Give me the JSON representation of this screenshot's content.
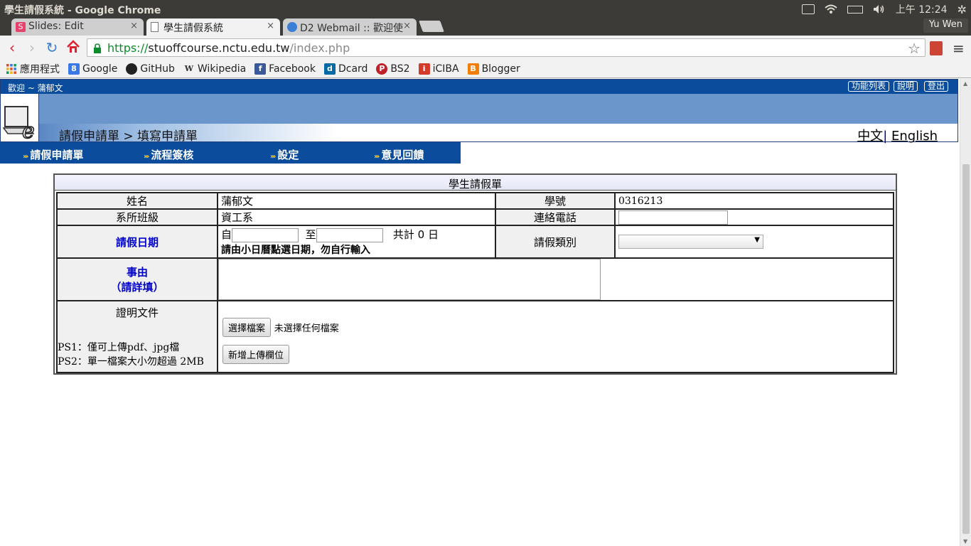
{
  "os": {
    "window_title": "學生請假系統 - Google Chrome",
    "clock": "上午 12:24"
  },
  "tabs": [
    {
      "label": "Slides: Edit",
      "active": false
    },
    {
      "label": "學生請假系統",
      "active": true
    },
    {
      "label": "D2 Webmail :: 歡迎使",
      "active": false
    }
  ],
  "profile_name": "Yu Wen",
  "address": {
    "scheme": "https://",
    "host": "stuoffcourse.nctu.edu.tw",
    "path": "/index.php"
  },
  "bookmarks": [
    {
      "label": "應用程式",
      "icon": "apps-grid-icon",
      "color": "#e34c26"
    },
    {
      "label": "Google",
      "icon": "google-icon",
      "color": "#3b78e7"
    },
    {
      "label": "GitHub",
      "icon": "github-icon",
      "color": "#222222"
    },
    {
      "label": "Wikipedia",
      "icon": "wikipedia-icon",
      "color": "#555555"
    },
    {
      "label": "Facebook",
      "icon": "facebook-icon",
      "color": "#3b5998"
    },
    {
      "label": "Dcard",
      "icon": "dcard-icon",
      "color": "#006aa6"
    },
    {
      "label": "BS2",
      "icon": "bs2-icon",
      "color": "#c0202a"
    },
    {
      "label": "iCIBA",
      "icon": "iciba-icon",
      "color": "#d33a2c"
    },
    {
      "label": "Blogger",
      "icon": "blogger-icon",
      "color": "#f57d00"
    }
  ],
  "header": {
    "welcome": "歡迎 ~ 蒲郁文",
    "links": [
      "功能列表",
      "說明",
      "登出"
    ],
    "breadcrumb": "請假申請單 > 填寫申請單",
    "lang_zh": "中文",
    "lang_sep": "|",
    "lang_en": "English"
  },
  "nav": [
    "請假申請單",
    "流程簽核",
    "設定",
    "意見回饋"
  ],
  "form": {
    "title": "學生請假單",
    "name_label": "姓名",
    "name_value": "蒲郁文",
    "student_id_label": "學號",
    "student_id_value": "0316213",
    "dept_label": "系所班級",
    "dept_value": "資工系",
    "phone_label": "連絡電話",
    "phone_value": "",
    "date_label": "請假日期",
    "date_from": "自",
    "date_to": "至",
    "date_total": "共計 0 日",
    "date_hint": "請由小日曆點選日期，勿自行輸入",
    "leave_type_label": "請假類別",
    "leave_type_value": "",
    "reason_label": "事由",
    "reason_hint": "（請詳填）",
    "doc_label": "證明文件",
    "ps1": "PS1：僅可上傳pdf、jpg檔",
    "ps2": "PS2：單一檔案大小勿超過 2MB",
    "choose_file_button": "選擇檔案",
    "no_file_text": "未選擇任何檔案",
    "add_upload_button": "新增上傳欄位"
  },
  "colors": {
    "header_blue": "#0b4d9c",
    "band_blue": "#6a96cc",
    "required_label": "#0000cc"
  }
}
